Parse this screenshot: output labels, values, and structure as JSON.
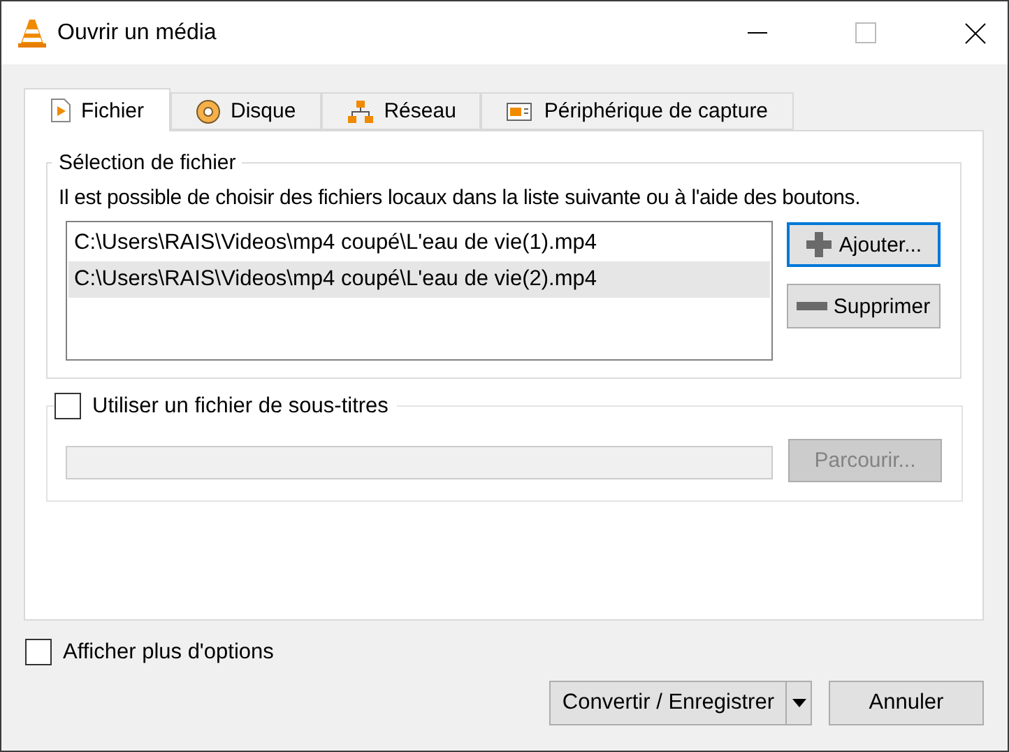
{
  "window": {
    "title": "Ouvrir un média"
  },
  "tabs": [
    {
      "label": "Fichier",
      "kind": "file",
      "selected": true
    },
    {
      "label": "Disque",
      "kind": "disc",
      "selected": false
    },
    {
      "label": "Réseau",
      "kind": "network",
      "selected": false
    },
    {
      "label": "Périphérique de capture",
      "kind": "capture",
      "selected": false
    }
  ],
  "file_selection": {
    "title": "Sélection de fichier",
    "description": "Il est possible de choisir des fichiers locaux dans la liste suivante ou à l'aide des boutons.",
    "files": [
      {
        "path": "C:\\Users\\RAIS\\Videos\\mp4 coupé\\L'eau de vie(1).mp4",
        "selected": false
      },
      {
        "path": "C:\\Users\\RAIS\\Videos\\mp4 coupé\\L'eau de vie(2).mp4",
        "selected": true
      }
    ],
    "add_button": {
      "label": "Ajouter...",
      "focused": true
    },
    "remove_button": {
      "label": "Supprimer",
      "focused": false
    }
  },
  "subtitles": {
    "label": "Utiliser un fichier de sous-titres",
    "checked": false,
    "browse_button": {
      "label": "Parcourir...",
      "disabled": true
    }
  },
  "more_options": {
    "label": "Afficher plus d'options",
    "checked": false
  },
  "buttons": [
    {
      "label": "Convertir / Enregistrer",
      "kind": "split"
    },
    {
      "label": "Annuler",
      "kind": "plain"
    }
  ]
}
